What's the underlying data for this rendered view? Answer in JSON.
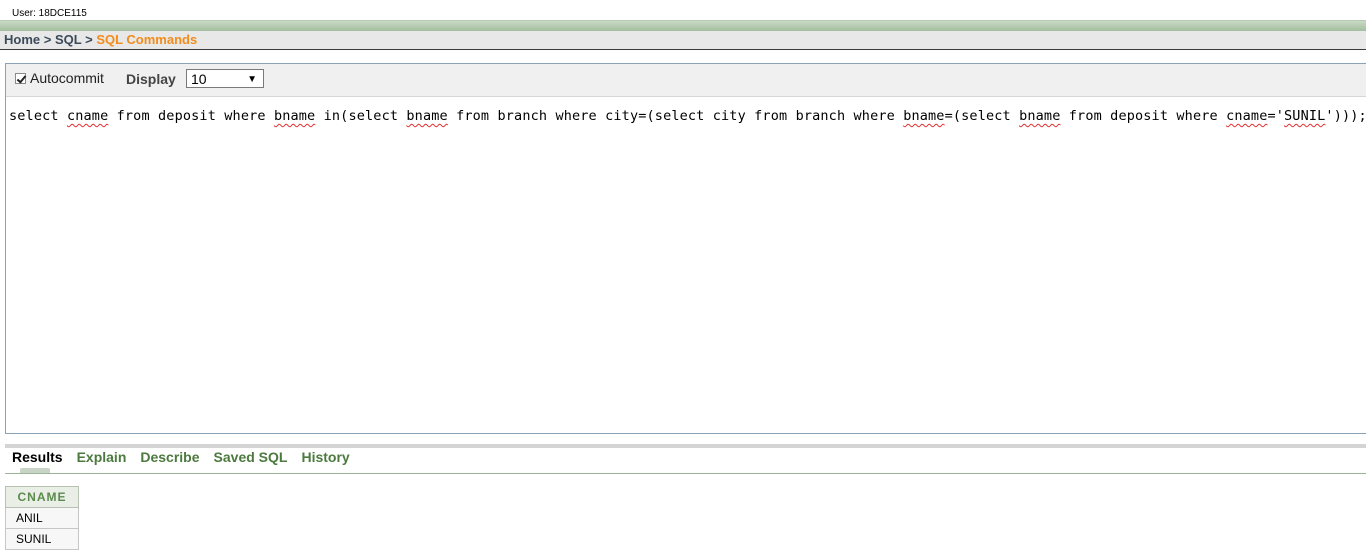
{
  "user_label": "User: 18DCE115",
  "breadcrumb": {
    "home": "Home",
    "sep1": ">",
    "sql": "SQL",
    "sep2": ">",
    "current": "SQL Commands"
  },
  "toolbar": {
    "autocommit_label": "Autocommit",
    "autocommit_checked": true,
    "display_label": "Display",
    "display_value": "10"
  },
  "editor": {
    "sql": "select cname from deposit where bname in(select bname from branch where city=(select city from branch where bname=(select bname from deposit where cname='SUNIL')));"
  },
  "tabs": [
    {
      "label": "Results",
      "active": true
    },
    {
      "label": "Explain",
      "active": false
    },
    {
      "label": "Describe",
      "active": false
    },
    {
      "label": "Saved SQL",
      "active": false
    },
    {
      "label": "History",
      "active": false
    }
  ],
  "results": {
    "columns": [
      "CNAME"
    ],
    "rows": [
      [
        "ANIL"
      ],
      [
        "SUNIL"
      ]
    ]
  },
  "colors": {
    "accent_orange": "#f28c1c",
    "tab_green": "#4c7a3e",
    "header_band": "#9fbb9a"
  }
}
